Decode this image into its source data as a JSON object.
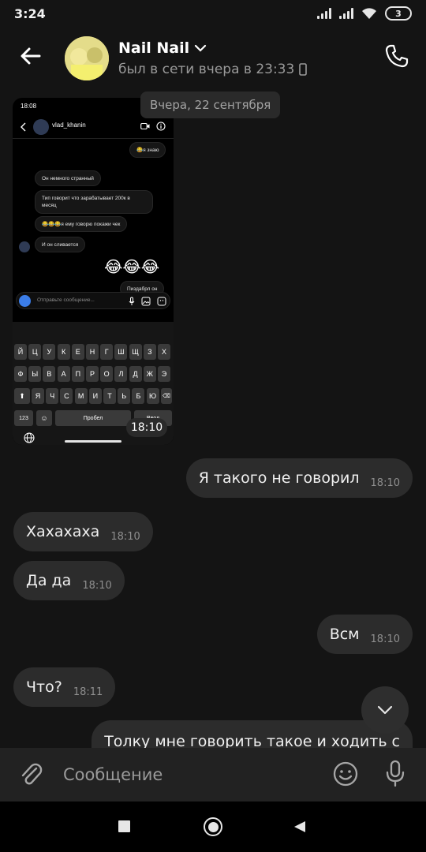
{
  "status_bar": {
    "time": "3:24",
    "battery": "3"
  },
  "header": {
    "name": "Nail Nail",
    "status": "был в сети вчера в 23:33"
  },
  "chat": {
    "date_label": "Вчера, 22 сентября",
    "attachment": {
      "status_time": "18:08",
      "username": "vlad_khanin",
      "messages": [
        {
          "text": "😂я знаю",
          "side": "out"
        },
        {
          "text": "Он немного странный",
          "side": "in"
        },
        {
          "text": "Тип говорит что зарабатывает 200к в месяц",
          "side": "in"
        },
        {
          "text": "😂😂😂я ему говорю покажи чек",
          "side": "in"
        },
        {
          "text": "И он сливается",
          "side": "in"
        },
        {
          "text": "😂😂😂",
          "side": "out"
        },
        {
          "text": "Пиздабрл он",
          "side": "out"
        }
      ],
      "input_placeholder": "Отправьте сообщение...",
      "keyboard": {
        "row1": [
          "Й",
          "Ц",
          "У",
          "К",
          "Е",
          "Н",
          "Г",
          "Ш",
          "Щ",
          "З",
          "Х"
        ],
        "row2": [
          "Ф",
          "Ы",
          "В",
          "А",
          "П",
          "Р",
          "О",
          "Л",
          "Д",
          "Ж",
          "Э"
        ],
        "row3": [
          "Я",
          "Ч",
          "С",
          "М",
          "И",
          "Т",
          "Ь",
          "Б",
          "Ю"
        ],
        "key_123": "123",
        "space": "Пробел",
        "enter": "Ввод"
      },
      "timestamp": "18:10"
    },
    "messages": [
      {
        "text": "Я такого не говорил",
        "time": "18:10",
        "side": "out"
      },
      {
        "text": "Хахахаха",
        "time": "18:10",
        "side": "in"
      },
      {
        "text": "Да да",
        "time": "18:10",
        "side": "in"
      },
      {
        "text": "Всм",
        "time": "18:10",
        "side": "out"
      },
      {
        "text": "Что?",
        "time": "18:11",
        "side": "in"
      },
      {
        "text": "Толку мне говорить такое и ходить с",
        "time": "",
        "side": "out"
      }
    ]
  },
  "composer": {
    "placeholder": "Сообщение"
  }
}
